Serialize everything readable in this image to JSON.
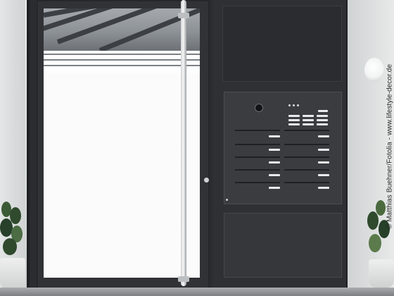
{
  "image": {
    "alt": "Dark grey front entrance door with frosted glass window film and an integrated mailbox and intercom side panel",
    "credit_text": "© Matthias Buehner/Fotolia - www.lifestyle-decor.de"
  },
  "colors": {
    "frame": "#2a2c2f",
    "glass_frosted": "#fbfbfb",
    "handle": "#e7e8e9",
    "mailbox_panel": "#3a3c40",
    "plant": "#2f4a2c"
  },
  "icons": {
    "camera": "camera-lens-icon",
    "lamp": "wall-lamp-icon"
  },
  "mailbox": {
    "columns": 2,
    "rows": 6,
    "bell_buttons": 10
  }
}
